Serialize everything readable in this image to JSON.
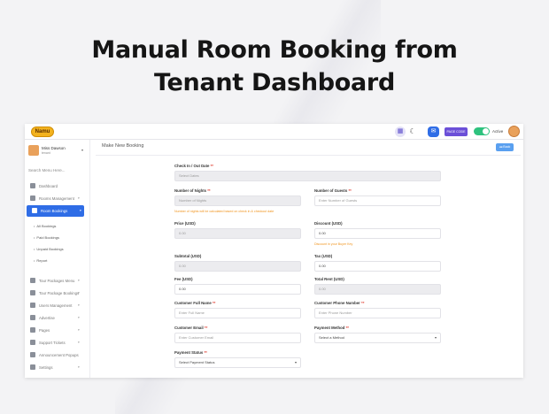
{
  "hero": {
    "line1": "Manual Room Booking from",
    "line2": "Tenant Dashboard"
  },
  "topbar": {
    "logo_text": "Namu",
    "grid_icon": "grid-icon",
    "moon_icon": "moon-icon",
    "message_icon": "message-icon",
    "button_label": "PAGE CODE",
    "toggle_label": "Active",
    "toggle_on": true
  },
  "sidebar": {
    "user_name": "Miss Dawson",
    "user_role": "tenant",
    "search_placeholder": "Search Menu Here...",
    "items": [
      {
        "label": "Dashboard",
        "icon": "dashboard-icon",
        "caret": ""
      },
      {
        "label": "Rooms Management",
        "icon": "rooms-icon",
        "caret": "▾"
      },
      {
        "label": "Room Bookings",
        "icon": "bookmark-icon",
        "caret": "▾",
        "active": true
      }
    ],
    "subitems": [
      "All Bookings",
      "Paid Bookings",
      "Unpaid Bookings",
      "Report"
    ],
    "items_after": [
      {
        "label": "Tour Packages Menu",
        "icon": "tour-icon",
        "caret": "▾"
      },
      {
        "label": "Tour Package Bookings",
        "icon": "tour-booking-icon",
        "caret": "▾"
      },
      {
        "label": "Users Management",
        "icon": "users-icon",
        "caret": "▾"
      },
      {
        "label": "Advertise",
        "icon": "advertise-icon",
        "caret": "▾"
      },
      {
        "label": "Pages",
        "icon": "pages-icon",
        "caret": "▾"
      },
      {
        "label": "Support Tickets",
        "icon": "ticket-icon",
        "caret": "▾"
      },
      {
        "label": "Announcement Popups",
        "icon": "megaphone-icon",
        "caret": ""
      },
      {
        "label": "Settings",
        "icon": "gear-icon",
        "caret": "▾"
      }
    ]
  },
  "main": {
    "title": "Make New Booking",
    "back_label": "◂◂ Back",
    "fields": {
      "checkin_label": "Check In / Out Date",
      "checkin_placeholder": "Select Dates",
      "nights_label": "Number of Nights",
      "nights_placeholder": "Number of Nights",
      "nights_hint": "Number of nights will be calculated based on check in & checkout date",
      "guests_label": "Number of Guests",
      "guests_placeholder": "Enter Number of Guests",
      "price_label": "Price (USD)",
      "price_value": "0.00",
      "discount_label": "Discount (USD)",
      "discount_value": "0.00",
      "discount_hint": "Discount in your Buyer Key",
      "subtotal_label": "Subtotal (USD)",
      "subtotal_value": "0.00",
      "tax_label": "Tax (USD)",
      "tax_value": "0.00",
      "fee_label": "Fee (USD)",
      "fee_value": "0.00",
      "total_label": "Total Rent (USD)",
      "total_value": "0.00",
      "name_label": "Customer Full Name",
      "name_placeholder": "Enter Full Name",
      "phone_label": "Customer Phone Number",
      "phone_placeholder": "Enter Phone Number",
      "email_label": "Customer Email",
      "email_placeholder": "Enter Customer Email",
      "payment_method_label": "Payment Method",
      "payment_method_value": "Select a Method",
      "payment_status_label": "Payment Status",
      "payment_status_value": "Select Payment Status",
      "required_mark": "**"
    }
  },
  "colors": {
    "accent": "#2f6de6",
    "toggle": "#2ec27e",
    "hint": "#f0941e",
    "required": "#e0463a"
  }
}
